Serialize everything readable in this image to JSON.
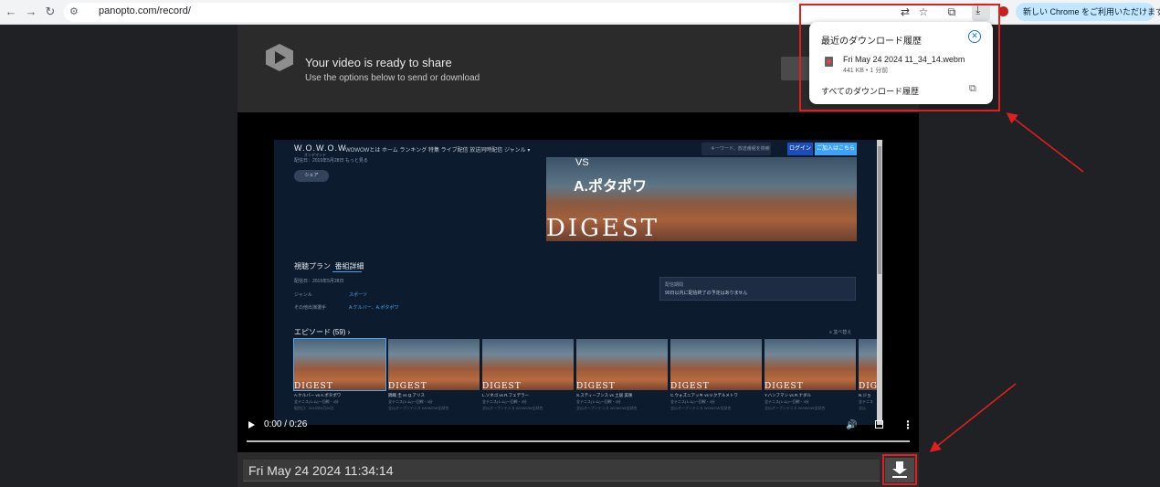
{
  "browser": {
    "url": "panopto.com/record/",
    "chrome_chip": "新しい Chrome をご利用いただけます"
  },
  "share": {
    "title": "Your video is ready to share",
    "subtitle": "Use the options below to send or download"
  },
  "embedded_page": {
    "logo": "W.O.W.O.W",
    "logo_sub": "オンデマンド",
    "nav": "WOWOWとは  ホーム  ランキング  特集  ライブ配信  放送同時配信  ジャンル ▾",
    "search_placeholder": "キーワード、放送番組を検索",
    "login": "ログイン",
    "join": "ご加入はこちら",
    "date_line": "配信日：2019年5月28日  もっと見る",
    "share_btn": "シェア",
    "hero_vs": "VS",
    "hero_name": "A.ポタポワ",
    "hero_digest": "DIGEST",
    "tab_plan": "視聴プラン",
    "tab_detail": "番組詳細",
    "detail_date": "配信日：2019年5月28日",
    "genre_label": "ジャンル",
    "genre_value": "スポーツ",
    "players_label": "その他出演選手",
    "players_value": "A.ケルバー、A.ポタポワ",
    "box_title": "配信期間",
    "box_text": "90日以内に配信終了の予定はありません",
    "episodes_title": "エピソード (59) ›",
    "episodes_all": "≡ 並べ替え",
    "episodes": [
      {
        "title": "DIGEST",
        "cap": "A.ケルバー vs A.ポタポワ",
        "sub": "全テニス(レム)一回戦・4分",
        "desc": "配信日：2019年5月28日"
      },
      {
        "title": "DIGEST",
        "cap": "錦織 圭 vs Q.アリス",
        "sub": "全テニス(レム)一回戦・4分",
        "desc": "全仏オープンテニス WOWOW全試合"
      },
      {
        "title": "DIGEST",
        "cap": "L.ソネゴ vs R.フェデラー",
        "sub": "全テニス(レム)一回戦・4分",
        "desc": "全仏オープンテニス WOWOW全試合"
      },
      {
        "title": "DIGEST",
        "cap": "S.スティーブンス vs 土居 美咲",
        "sub": "全テニス(レム)一回戦・4分",
        "desc": "全仏オープンテニス WOWOW全試合"
      },
      {
        "title": "DIGEST",
        "cap": "C.ウォズニアッキ vs V.クデルメトワ",
        "sub": "全テニス(レム)一回戦・4分",
        "desc": "全仏オープンテニス WOWOW全試合"
      },
      {
        "title": "DIGEST",
        "cap": "Y.ハンフマン vs R.ナダル",
        "sub": "全テニス(レム)一回戦・4分",
        "desc": "全仏オープンテニス WOWOW全試合"
      },
      {
        "title": "DIG",
        "cap": "N.ジョ",
        "sub": "全テニス",
        "desc": "全仏"
      }
    ]
  },
  "video": {
    "time": "0:00 / 0:26"
  },
  "filename": "Fri May 24 2024 11:34:14",
  "downloads_popover": {
    "title": "最近のダウンロード履歴",
    "file_name": "Fri May 24 2024 11_34_14.webm",
    "file_meta": "441 KB • 1 分前",
    "all_link": "すべてのダウンロード履歴"
  },
  "colors": {
    "annotation": "#e02020",
    "accent": "#1a73e8"
  }
}
